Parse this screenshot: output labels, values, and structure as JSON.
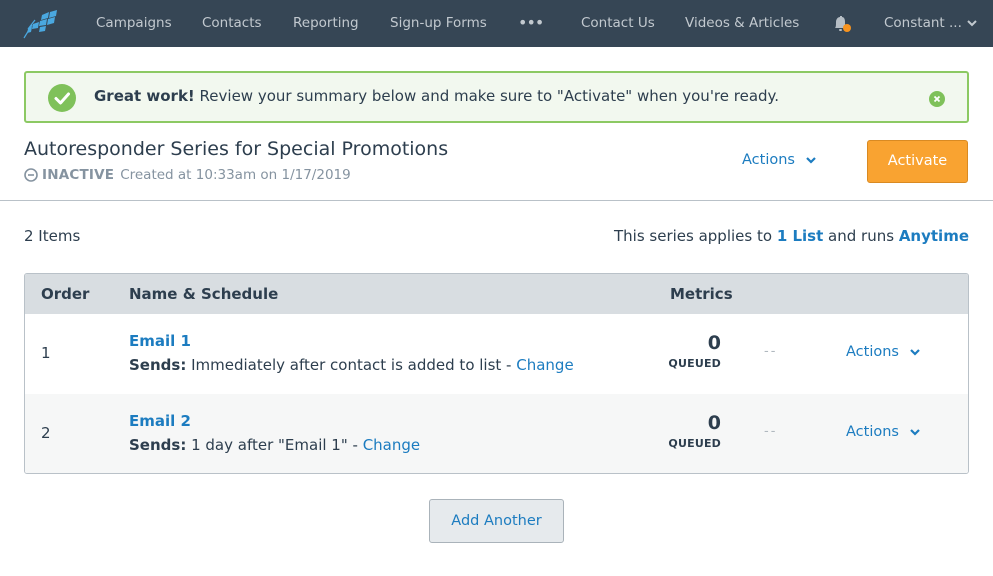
{
  "nav": {
    "items": [
      {
        "label": "Campaigns"
      },
      {
        "label": "Contacts"
      },
      {
        "label": "Reporting"
      },
      {
        "label": "Sign-up Forms"
      }
    ],
    "more_label": "•••",
    "right_items": [
      {
        "label": "Contact Us"
      },
      {
        "label": "Videos & Articles"
      }
    ],
    "account_label": "Constant ...",
    "notification_dot_color": "#f7931e",
    "logo_icon": "constant-contact-logo-icon"
  },
  "banner": {
    "bold": "Great work!",
    "text": " Review your summary below and make sure to \"Activate\" when you're ready.",
    "color": "#8cc963"
  },
  "header": {
    "title": "Autoresponder Series for Special Promotions",
    "status": "INACTIVE",
    "created": "Created at 10:33am on 1/17/2019",
    "actions_label": "Actions",
    "activate_label": "Activate",
    "activate_color": "#f9a331"
  },
  "summary": {
    "items_count": "2 Items",
    "applies_prefix": "This series applies to ",
    "list_link": "1 List",
    "applies_middle": " and runs ",
    "runs_link": "Anytime"
  },
  "table": {
    "headers": {
      "order": "Order",
      "name": "Name & Schedule",
      "metrics": "Metrics"
    },
    "rows": [
      {
        "order": "1",
        "name": "Email 1",
        "sends_label": "Sends:",
        "sends_text": " Immediately after contact is added to list - ",
        "change_label": "Change",
        "metric_value": "0",
        "metric_label": "QUEUED",
        "metric_dash": "--",
        "actions_label": "Actions"
      },
      {
        "order": "2",
        "name": "Email 2",
        "sends_label": "Sends:",
        "sends_text": " 1 day after \"Email 1\" - ",
        "change_label": "Change",
        "metric_value": "0",
        "metric_label": "QUEUED",
        "metric_dash": "--",
        "actions_label": "Actions"
      }
    ]
  },
  "add_another_label": "Add Another"
}
